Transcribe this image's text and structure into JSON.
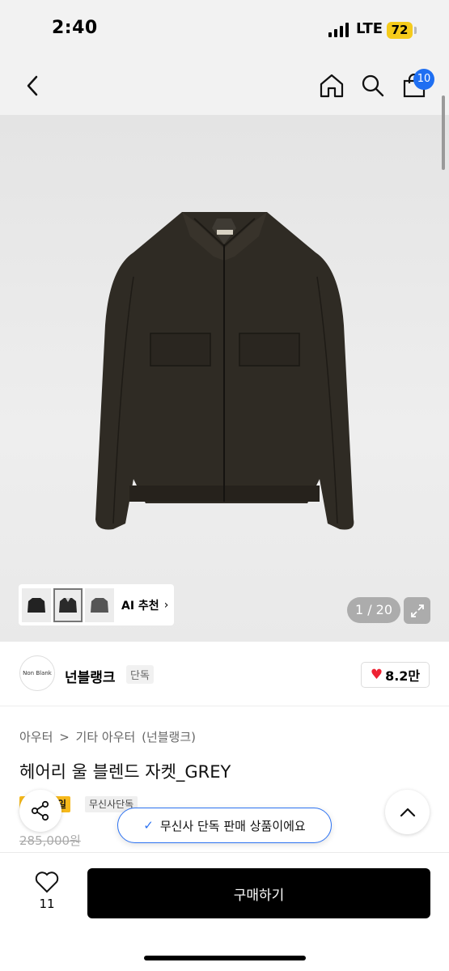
{
  "status_bar": {
    "time": "2:40",
    "network": "LTE",
    "battery": "72"
  },
  "nav": {
    "bag_count": "10"
  },
  "gallery": {
    "counter": "1 / 20",
    "ai_label": "AI 추천"
  },
  "brand": {
    "logo_text": "Non Blank",
    "name": "넌블랭크",
    "tag": "단독",
    "likes": "8.2만"
  },
  "product": {
    "breadcrumb": [
      "아우터",
      ">",
      "기타 아우터",
      "(넌블랭크)"
    ],
    "title": "헤어리 울 블렌드 자켓_GREY",
    "sale_badge": "세일",
    "exclusive_badge": "무신사단독",
    "original_price": "285,000원"
  },
  "toast": {
    "message": "무신사 단독 판매 상품이에요"
  },
  "bottom_bar": {
    "favorite_count": "11",
    "buy_label": "구매하기"
  },
  "colors": {
    "accent": "#2d73f2",
    "badge": "#1f6ff2",
    "sale": "#f6b91b",
    "heart": "#ee2233",
    "jacket": "#2f2b24"
  }
}
